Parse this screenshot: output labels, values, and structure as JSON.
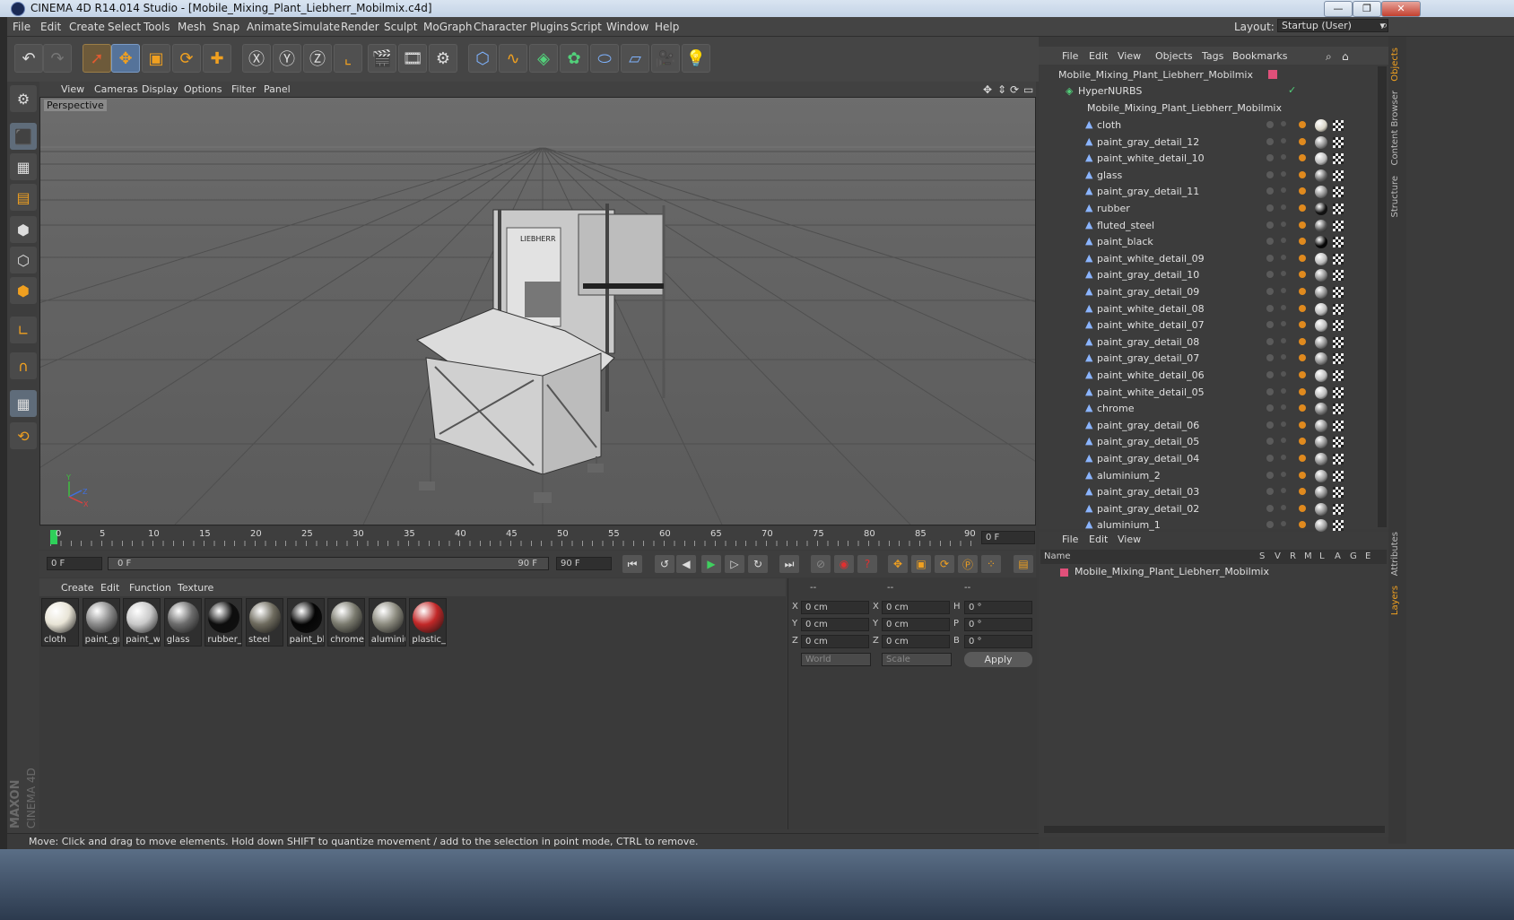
{
  "window": {
    "title": "CINEMA 4D R14.014 Studio - [Mobile_Mixing_Plant_Liebherr_Mobilmix.c4d]",
    "minimize": "—",
    "maximize": "❐",
    "close": "✕"
  },
  "menubar": {
    "items": [
      "File",
      "Edit",
      "Create",
      "Select",
      "Tools",
      "Mesh",
      "Snap",
      "Animate",
      "Simulate",
      "Render",
      "Sculpt",
      "MoGraph",
      "Character",
      "Plugins",
      "Script",
      "Window",
      "Help"
    ],
    "layout_label": "Layout:",
    "layout_value": "Startup (User)"
  },
  "viewport": {
    "menu": [
      "View",
      "Cameras",
      "Display",
      "Options",
      "Filter",
      "Panel"
    ],
    "label": "Perspective",
    "axis": {
      "y": "Y",
      "z": "Z",
      "x": "X"
    },
    "logo_text": "LIEBHERR"
  },
  "timeline": {
    "ticks": [
      "0",
      "5",
      "10",
      "15",
      "20",
      "25",
      "30",
      "35",
      "40",
      "45",
      "50",
      "55",
      "60",
      "65",
      "70",
      "75",
      "80",
      "85",
      "90"
    ],
    "current_frame": "0 F",
    "start": "0 F",
    "range_start": "0 F",
    "range_end": "90 F",
    "end": "90 F"
  },
  "materials": {
    "menu": [
      "Create",
      "Edit",
      "Function",
      "Texture"
    ],
    "items": [
      {
        "label": "cloth",
        "color": "#e8e4d6"
      },
      {
        "label": "paint_gr",
        "color": "#8a8a8a"
      },
      {
        "label": "paint_w",
        "color": "#c9c9c9"
      },
      {
        "label": "glass",
        "color": "#6c6c6c"
      },
      {
        "label": "rubber_",
        "color": "#0d0d0d"
      },
      {
        "label": "steel",
        "color": "#6e6b5e"
      },
      {
        "label": "paint_bl",
        "color": "#050505"
      },
      {
        "label": "chrome",
        "color": "#7a7a6e"
      },
      {
        "label": "aluminiu",
        "color": "#8b8a7e"
      },
      {
        "label": "plastic_r",
        "color": "#c22828"
      }
    ]
  },
  "coords": {
    "headers": [
      "--",
      "--",
      "--"
    ],
    "rows": [
      {
        "a": "X",
        "av": "0 cm",
        "b": "X",
        "bv": "0 cm",
        "c": "H",
        "cv": "0 °"
      },
      {
        "a": "Y",
        "av": "0 cm",
        "b": "Y",
        "bv": "0 cm",
        "c": "P",
        "cv": "0 °"
      },
      {
        "a": "Z",
        "av": "0 cm",
        "b": "Z",
        "bv": "0 cm",
        "c": "B",
        "cv": "0 °"
      }
    ],
    "mode1": "World",
    "mode2": "Scale",
    "apply": "Apply"
  },
  "objects": {
    "menu": [
      "File",
      "Edit",
      "View",
      "Objects",
      "Tags",
      "Bookmarks"
    ],
    "root": "Mobile_Mixing_Plant_Liebherr_Mobilmix",
    "hypernurbs": "HyperNURBS",
    "group": "Mobile_Mixing_Plant_Liebherr_Mobilmix",
    "items": [
      "cloth",
      "paint_gray_detail_12",
      "paint_white_detail_10",
      "glass",
      "paint_gray_detail_11",
      "rubber",
      "fluted_steel",
      "paint_black",
      "paint_white_detail_09",
      "paint_gray_detail_10",
      "paint_gray_detail_09",
      "paint_white_detail_08",
      "paint_white_detail_07",
      "paint_gray_detail_08",
      "paint_gray_detail_07",
      "paint_white_detail_06",
      "paint_white_detail_05",
      "chrome",
      "paint_gray_detail_06",
      "paint_gray_detail_05",
      "paint_gray_detail_04",
      "aluminium_2",
      "paint_gray_detail_03",
      "paint_gray_detail_02",
      "aluminium_1"
    ]
  },
  "layers": {
    "menu": [
      "File",
      "Edit",
      "View"
    ],
    "columns": [
      "Name",
      "S",
      "V",
      "R",
      "M",
      "L",
      "A",
      "G",
      "E"
    ],
    "row": "Mobile_Mixing_Plant_Liebherr_Mobilmix",
    "row_color": "#e0507a"
  },
  "right_tabs": [
    "Objects",
    "Content Browser",
    "Structure",
    "Attributes",
    "Layers"
  ],
  "status": "Move: Click and drag to move elements. Hold down SHIFT to quantize movement / add to the selection in point mode, CTRL to remove.",
  "brand": {
    "maxon": "MAXON",
    "c4d": "CINEMA 4D"
  }
}
